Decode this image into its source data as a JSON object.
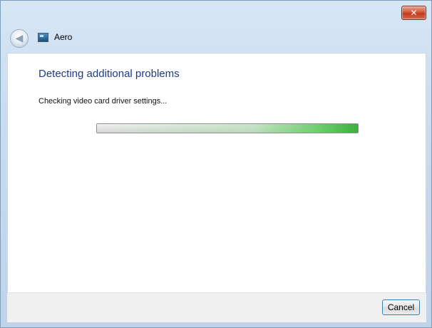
{
  "window": {
    "title": "Aero",
    "close_symbol": "✕",
    "back_symbol": "◀"
  },
  "content": {
    "heading": "Detecting additional problems",
    "status": "Checking video card driver settings..."
  },
  "progress": {
    "state": "indeterminate",
    "fill_color": "#3bb13b",
    "level_percent": 100
  },
  "footer": {
    "cancel_label": "Cancel"
  },
  "colors": {
    "heading": "#1e3a8a",
    "chrome": "#c9dbee"
  }
}
